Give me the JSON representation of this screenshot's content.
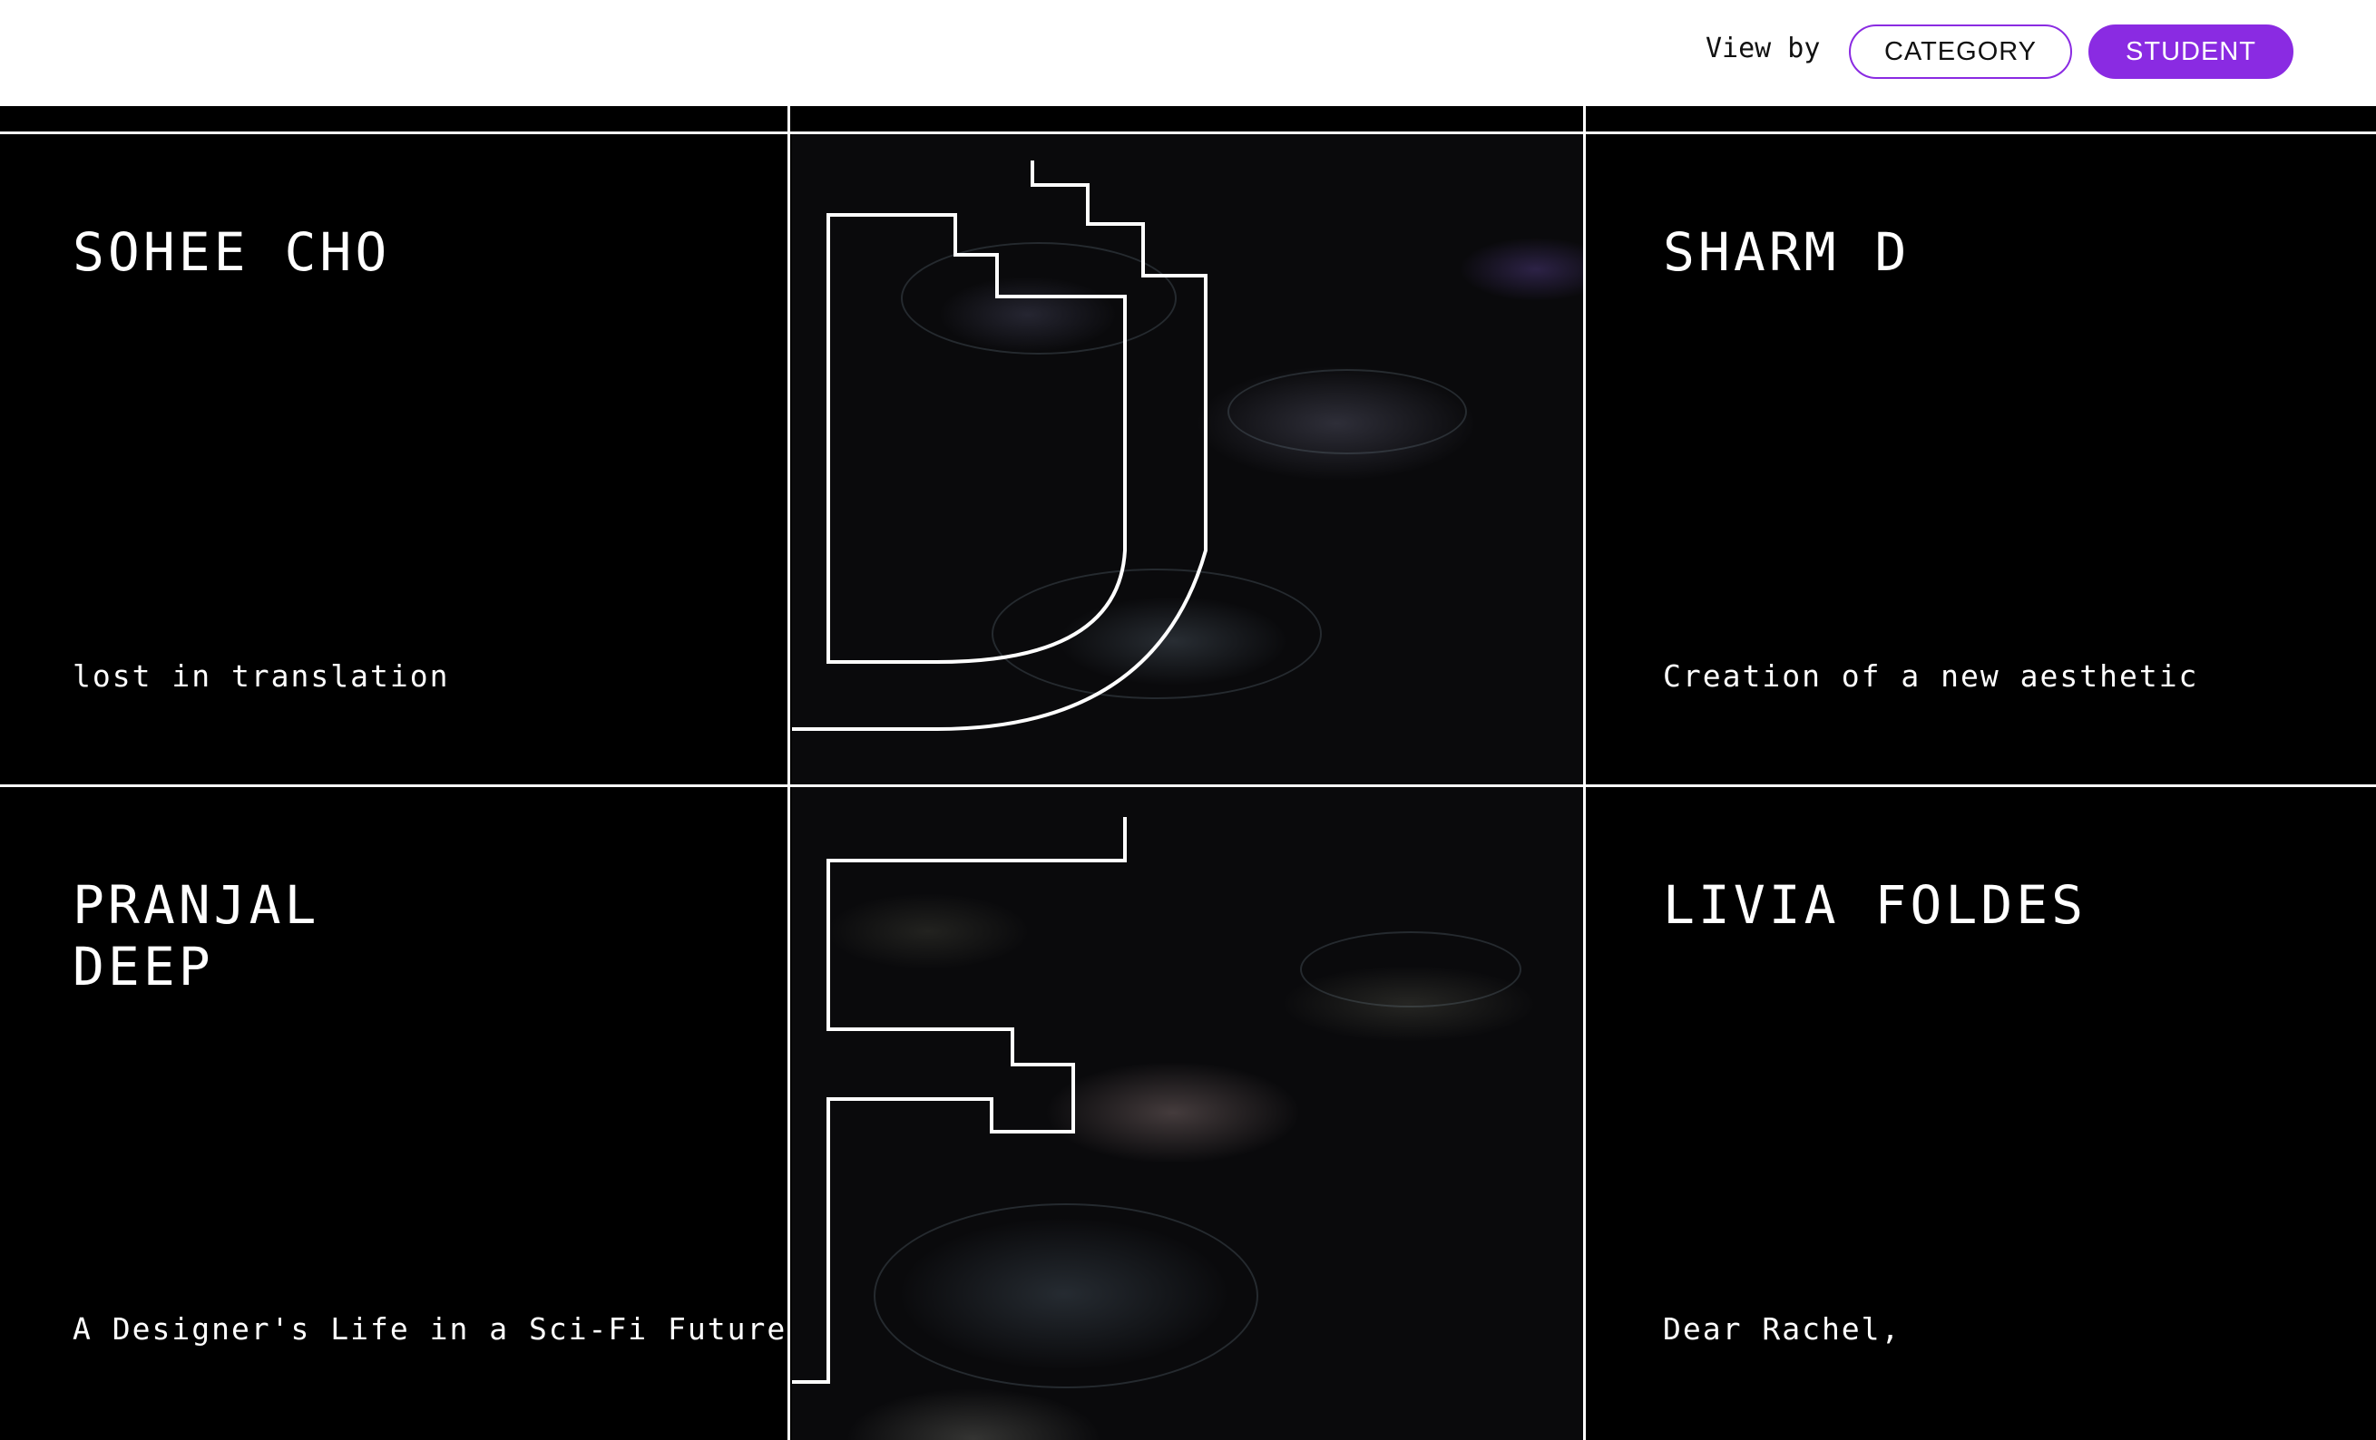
{
  "toolbar": {
    "view_by_label": "View by",
    "category_label": "CATEGORY",
    "student_label": "STUDENT",
    "active": "STUDENT",
    "accent_color": "#8a2be2"
  },
  "projects": [
    {
      "student": "SOHEE CHO",
      "title": "lost in translation"
    },
    {
      "student": "SHARM D",
      "title": "Creation of a new aesthetic"
    },
    {
      "student": "PRANJAL DEEP",
      "title": "A Designer's Life in a Sci-Fi Future"
    },
    {
      "student": "LIVIA FOLDES",
      "title": "Dear Rachel,"
    }
  ],
  "art": {
    "logo_letters": [
      "D",
      "F"
    ]
  }
}
